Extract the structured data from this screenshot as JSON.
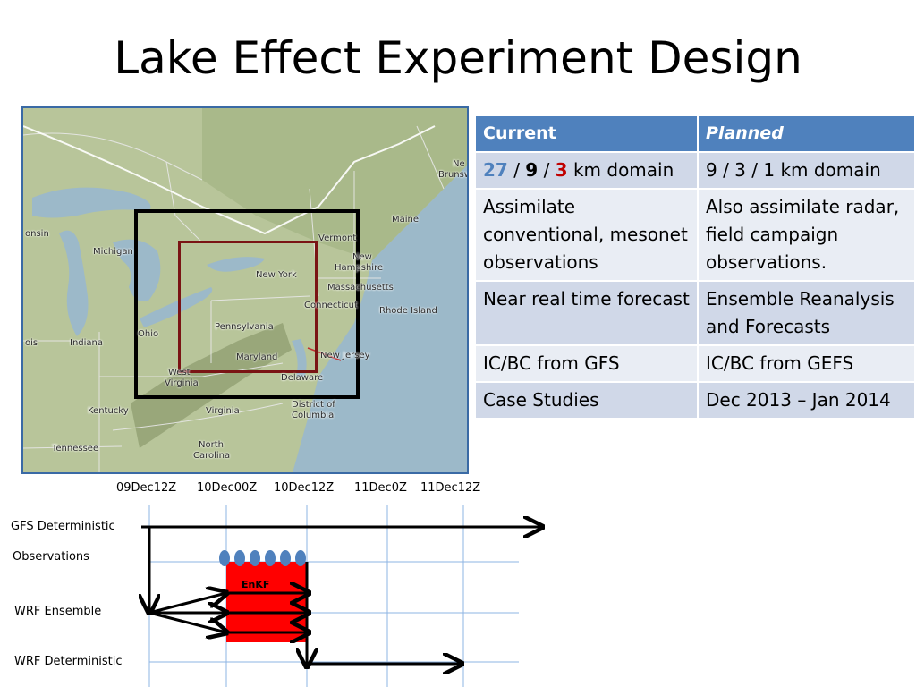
{
  "slide": {
    "title": "Lake Effect Experiment Design"
  },
  "map": {
    "labels": {
      "michigan": "Michigan",
      "wisconsin": "onsin",
      "ohio": "Ohio",
      "indiana": "Indiana",
      "illinois": "ois",
      "kentucky": "Kentucky",
      "tennessee": "Tennessee",
      "virginia": "Virginia",
      "west_virginia_a": "West",
      "west_virginia_b": "Virginia",
      "north_carolina_a": "North",
      "north_carolina_b": "Carolina",
      "pennsylvania": "Pennsylvania",
      "maryland": "Maryland",
      "delaware": "Delaware",
      "dc_a": "District of",
      "dc_b": "Columbia",
      "new_jersey": "New Jersey",
      "new_york": "New York",
      "vermont": "Vermont",
      "new_hampshire_a": "New",
      "new_hampshire_b": "Hampshire",
      "massachusetts": "Massachusetts",
      "connecticut": "Connecticut",
      "rhode_island": "Rhode Island",
      "maine": "Maine",
      "new_brunswick_a": "Ne",
      "new_brunswick_b": "Brunsw"
    },
    "colors": {
      "outer_domain": "#000000",
      "inner_domain": "#7a1414"
    }
  },
  "table": {
    "headers": {
      "current": "Current",
      "planned": "Planned"
    },
    "row1": {
      "current_n1": "27",
      "sep1": " / ",
      "current_n2": "9",
      "sep2": " / ",
      "current_n3": "3",
      "current_suffix": " km domain",
      "planned": "9 / 3 / 1 km domain"
    },
    "row2": {
      "current": "Assimilate conventional, mesonet observations",
      "planned": "Also assimilate radar, field campaign observations."
    },
    "row3": {
      "current": "Near real time forecast",
      "planned": "Ensemble Reanalysis and Forecasts"
    },
    "row4": {
      "current": "IC/BC from GFS",
      "planned": "IC/BC from GEFS"
    },
    "row5": {
      "current": "Case Studies",
      "planned": "Dec 2013 – Jan 2014"
    },
    "colors": {
      "header": "#4f81bd",
      "row_odd": "#d0d8e8",
      "row_even": "#e9edf4",
      "n1": "#4f81bd",
      "n3": "#c00000"
    }
  },
  "timeline": {
    "times": [
      "09Dec12Z",
      "10Dec00Z",
      "10Dec12Z",
      "11Dec0Z",
      "11Dec12Z"
    ],
    "rows": [
      "GFS Deterministic",
      "Observations",
      "WRF Ensemble",
      "WRF Deterministic"
    ],
    "enkf_label": "EnKF",
    "colors": {
      "enkf_box": "#ff0000",
      "obs_marker": "#4f81bd",
      "grid": "#8eb4e3"
    }
  }
}
